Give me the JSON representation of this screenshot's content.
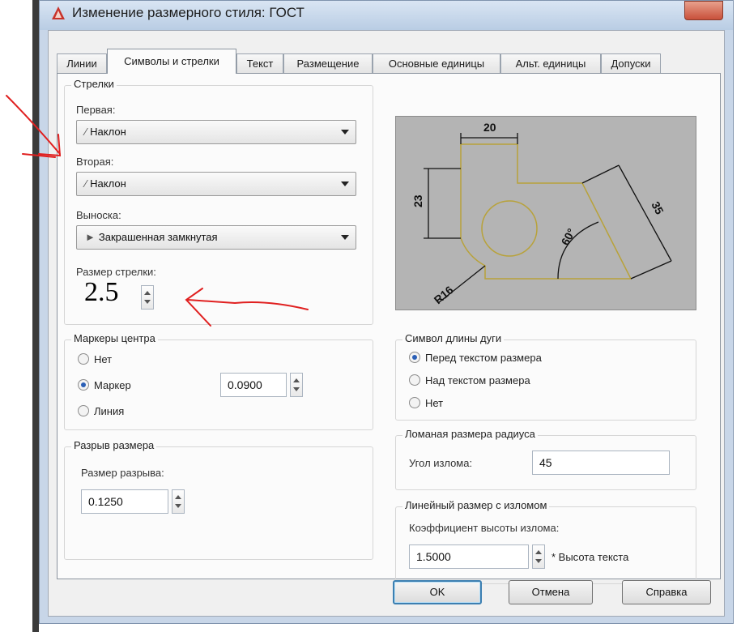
{
  "window": {
    "title": "Изменение размерного стиля: ГОСТ"
  },
  "tabs": [
    "Линии",
    "Символы и стрелки",
    "Текст",
    "Размещение",
    "Основные единицы",
    "Альт. единицы",
    "Допуски"
  ],
  "arrows": {
    "group_title": "Стрелки",
    "first_label": "Первая:",
    "first_value": "Наклон",
    "second_label": "Вторая:",
    "second_value": "Наклон",
    "leader_label": "Выноска:",
    "leader_value": "Закрашенная замкнутая",
    "size_label": "Размер стрелки:",
    "size_value": "2.5"
  },
  "center_marks": {
    "group_title": "Маркеры центра",
    "options": [
      "Нет",
      "Маркер",
      "Линия"
    ],
    "selected": "Маркер",
    "value": "0.0900"
  },
  "dim_break": {
    "group_title": "Разрыв размера",
    "size_label": "Размер разрыва:",
    "size_value": "0.1250"
  },
  "preview": {
    "dim_20": "20",
    "dim_23": "23",
    "dim_35": "35",
    "dim_60": "60°",
    "dim_r16": "R16"
  },
  "arc_symbol": {
    "group_title": "Символ длины дуги",
    "options": [
      "Перед текстом размера",
      "Над текстом размера",
      "Нет"
    ],
    "selected": "Перед текстом размера"
  },
  "radius_jog": {
    "group_title": "Ломаная размера радиуса",
    "angle_label": "Угол излома:",
    "angle_value": "45"
  },
  "linear_jog": {
    "group_title": "Линейный размер с изломом",
    "factor_label": "Коэффициент высоты излома:",
    "factor_value": "1.5000",
    "factor_suffix": "* Высота текста"
  },
  "buttons": {
    "ok": "OK",
    "cancel": "Отмена",
    "help": "Справка"
  },
  "colors": {
    "accent": "#2a5fb6",
    "annotation": "#e02020",
    "preview_bg": "#b4b4b4",
    "preview_lines": "#b8a23a"
  }
}
